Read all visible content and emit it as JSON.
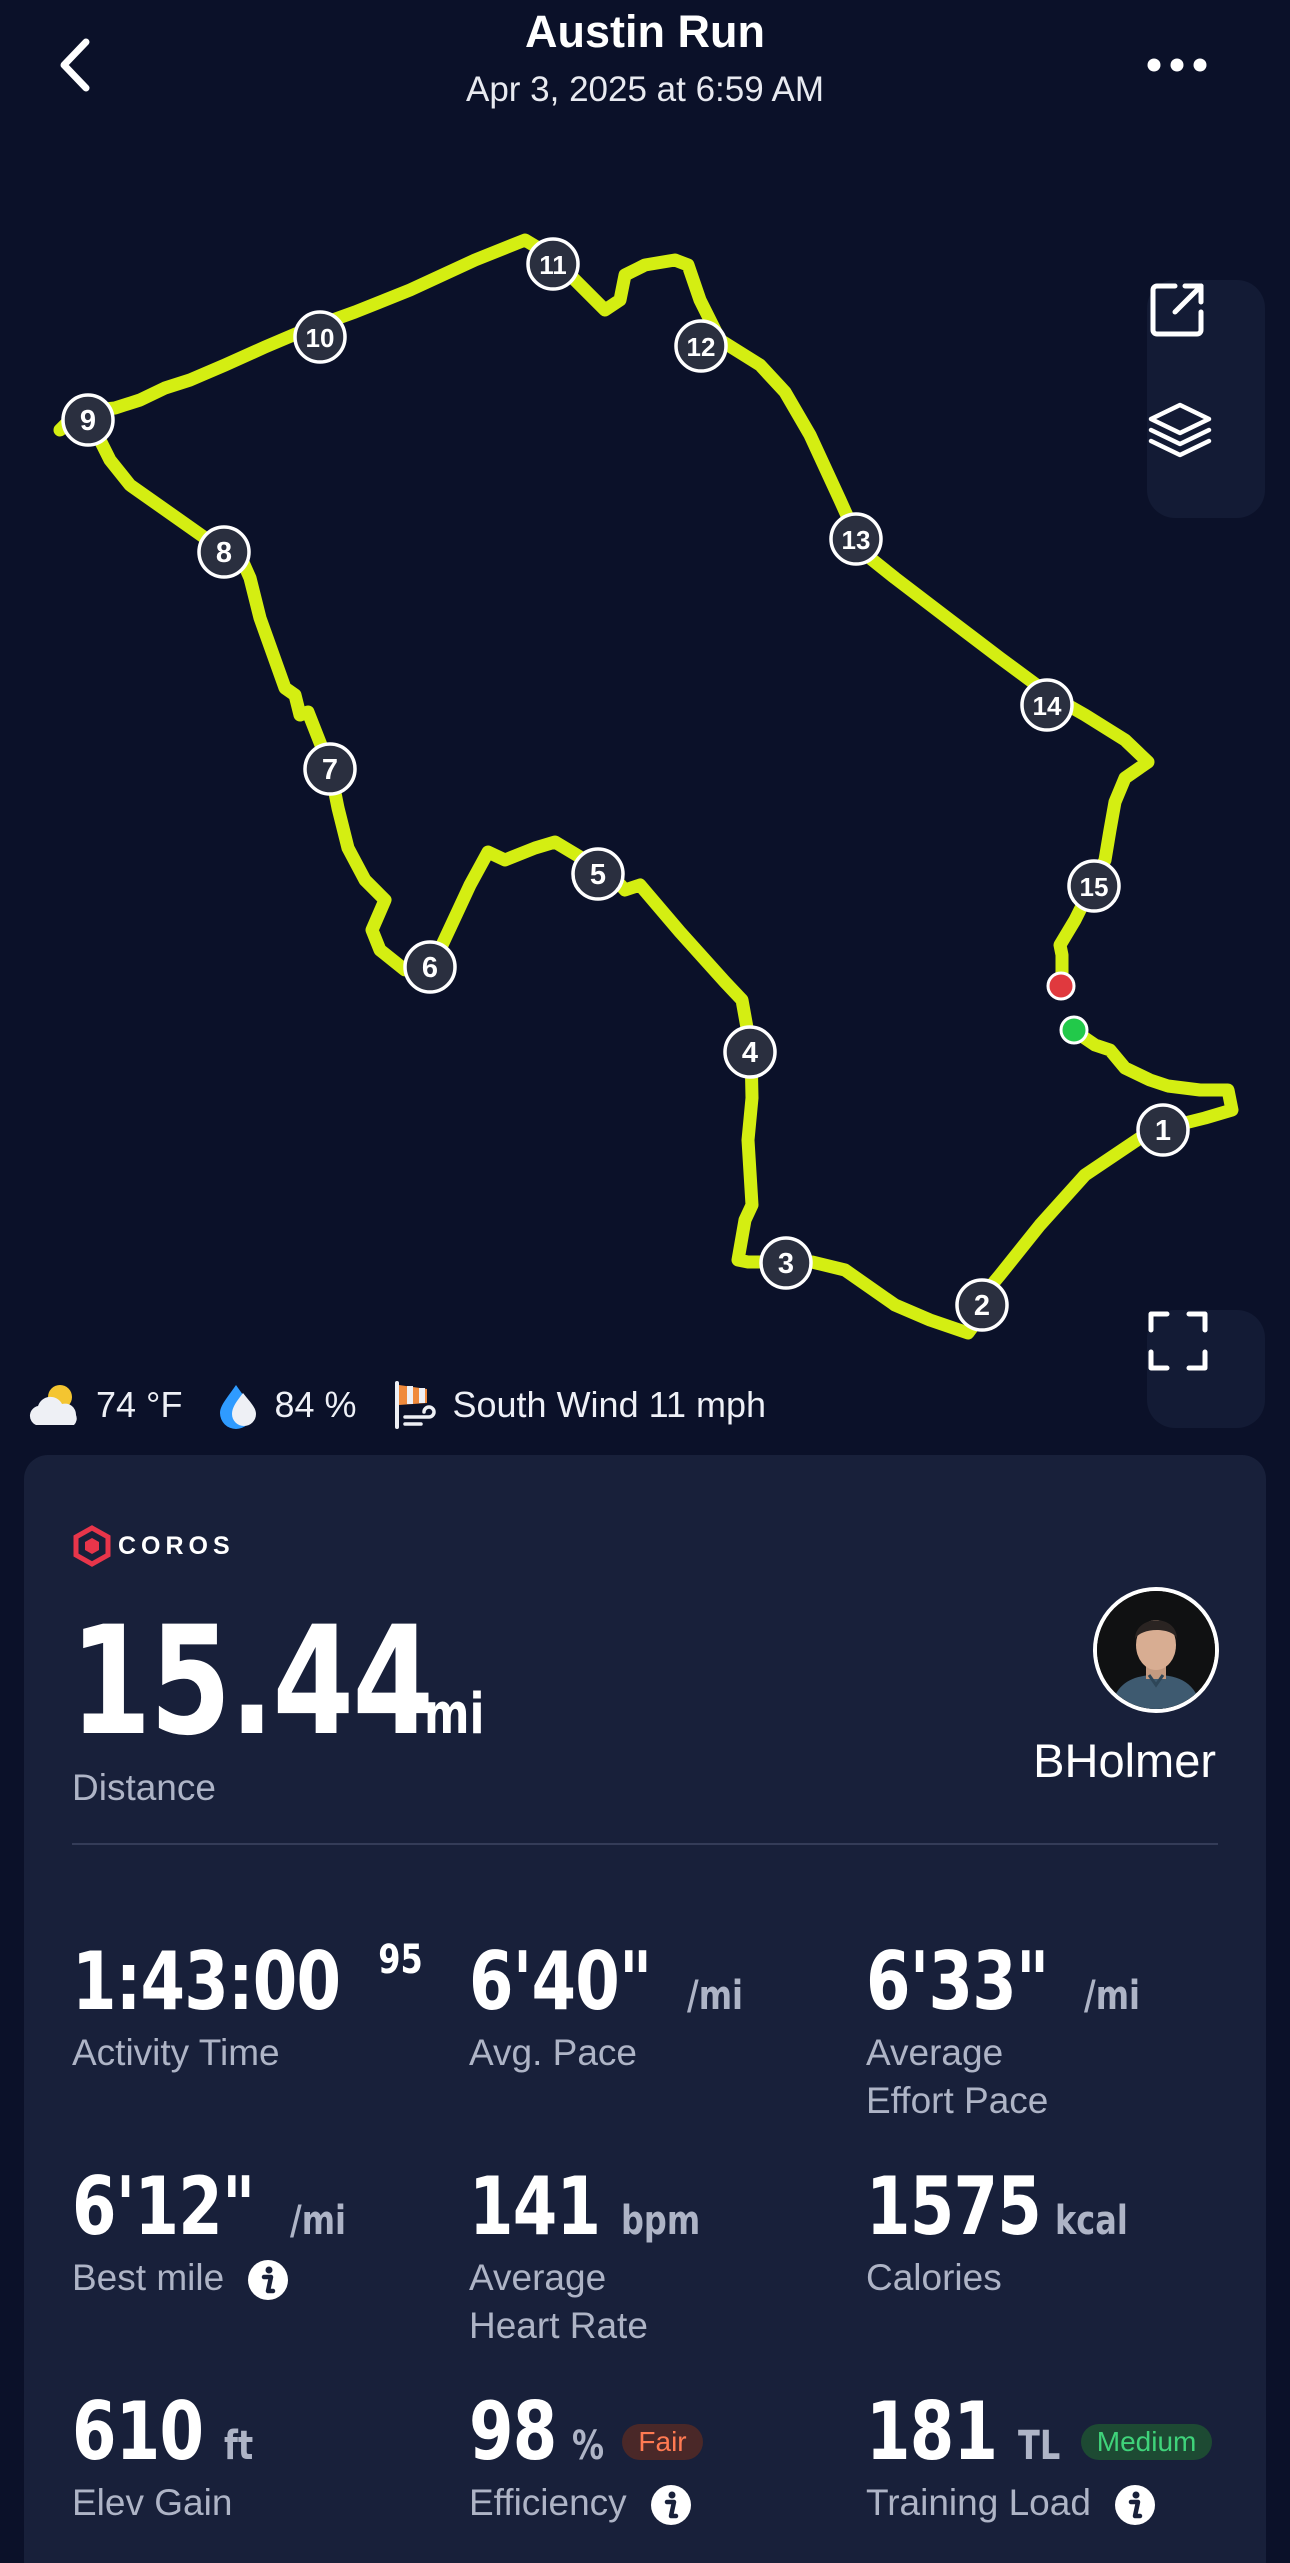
{
  "header": {
    "title": "Austin Run",
    "subtitle": "Apr 3, 2025 at 6:59 AM"
  },
  "map": {
    "route_color": "#d4ee12",
    "start_color": "#22c94a",
    "end_color": "#e0393e",
    "mile_markers": [
      "1",
      "2",
      "3",
      "4",
      "5",
      "6",
      "7",
      "8",
      "9",
      "10",
      "11",
      "12",
      "13",
      "14",
      "15"
    ]
  },
  "weather": {
    "temperature": "74 °F",
    "humidity": "84 %",
    "wind": "South Wind 11 mph"
  },
  "card": {
    "brand": "COROS",
    "distance_value": "15.44",
    "distance_unit": "mi",
    "distance_label": "Distance",
    "username": "BHolmer",
    "metrics": [
      {
        "value": "1:43:00",
        "extra": "95",
        "unit": "",
        "label": "Activity Time"
      },
      {
        "value": "6'40\"",
        "unit": "/mi",
        "label": "Avg. Pace"
      },
      {
        "value": "6'33\"",
        "unit": "/mi",
        "label_line1": "Average",
        "label_line2": "Effort Pace"
      },
      {
        "value": "6'12\"",
        "unit": "/mi",
        "label": "Best mile"
      },
      {
        "value": "141",
        "unit": "bpm",
        "label_line1": "Average",
        "label_line2": "Heart Rate"
      },
      {
        "value": "1575",
        "unit": "kcal",
        "label": "Calories"
      },
      {
        "value": "610",
        "unit": "ft",
        "label": "Elev Gain"
      },
      {
        "value": "98",
        "unit": "%",
        "badge": "Fair",
        "label": "Efficiency"
      },
      {
        "value": "181",
        "unit": "TL",
        "badge": "Medium",
        "label": "Training Load"
      }
    ]
  }
}
